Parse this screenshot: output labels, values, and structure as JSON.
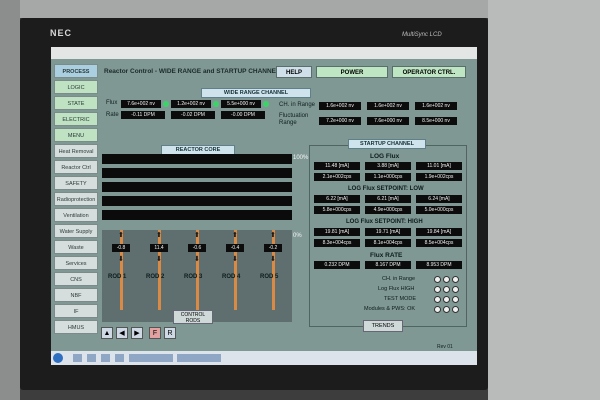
{
  "monitor": {
    "brand": "NEC",
    "model": "MultiSync LCD"
  },
  "header": {
    "title": "Reactor Control - WIDE RANGE and STARTUP CHANNEL",
    "help": "HELP",
    "power": "POWER",
    "operator": "OPERATOR CTRL."
  },
  "nav": [
    "PROCESS",
    "LOGIC",
    "STATE",
    "ELECTRIC",
    "MENU",
    "Heat Removal",
    "Reactor Ctrl",
    "SAFETY",
    "Radioprotection",
    "Ventilation",
    "Water Supply",
    "Waste",
    "Services",
    "CNS",
    "NBF",
    "IF",
    "HMUS"
  ],
  "wide_range": {
    "label": "WIDE RANGE CHANNEL",
    "flux_label": "Flux",
    "rate_label": "Rate",
    "flux_values": [
      "7.6e+002 nv",
      "1.2e+002 nv",
      "5.5e+000 nv"
    ],
    "rate_values": [
      "-0.11 DPM",
      "-0.02 DPM",
      "-0.00 DPM"
    ],
    "ch_in_range_label": "CH. in Range",
    "ch_in_range_values": [
      "1.6e+002 nv",
      "1.6e+002 nv",
      "1.6e+002 nv"
    ],
    "fluct_label": "Fluctuation Range",
    "fluct_values": [
      "7.2e+000 nv",
      "7.6e+000 nv",
      "8.5e+000 nv"
    ]
  },
  "core": {
    "label": "REACTOR CORE",
    "pct_top": "100%",
    "pct_bottom": "0%",
    "rods": [
      {
        "name": "ROD 1",
        "value": "-0.8"
      },
      {
        "name": "ROD 2",
        "value": "11.4"
      },
      {
        "name": "ROD 3",
        "value": "-0.6"
      },
      {
        "name": "ROD 4",
        "value": "-0.4"
      },
      {
        "name": "ROD 5",
        "value": "-0.2"
      }
    ],
    "control_rods_btn": "CONTROL RODS"
  },
  "startup": {
    "label": "STARTUP CHANNEL",
    "log_flux": "LOG Flux",
    "log_flux_ma": [
      "11.48 [mA]",
      "3.88 [mA]",
      "11.01 [mA]"
    ],
    "log_flux_cps": [
      "2.1e+002cps",
      "1.1e+000cps",
      "1.9e+002cps"
    ],
    "low_label": "LOG Flux SETPOINT: LOW",
    "low_ma": [
      "6.22 [mA]",
      "6.21 [mA]",
      "6.24 [mA]"
    ],
    "low_cps": [
      "5.8e+000cps",
      "4.9e+000cps",
      "5.0e+000cps"
    ],
    "high_label": "LOG Flux SETPOINT: HIGH",
    "high_ma": [
      "19.81 [mA]",
      "19.71 [mA]",
      "19.84 [mA]"
    ],
    "high_cps": [
      "8.3e+004cps",
      "8.1e+004cps",
      "8.5e+004cps"
    ],
    "flux_rate": "Flux RATE",
    "flux_rate_values": [
      "0.232 DPM",
      "8.167 DPM",
      "8.953 DPM"
    ],
    "indicators": [
      "CH. in Range",
      "Log Flux HIGH",
      "TEST MODE",
      "Modules & PWS: OK"
    ],
    "trends": "TRENDS"
  },
  "footer": {
    "rev": "Rev 01"
  },
  "colors": {
    "screen_bg": "#7f9894",
    "value_bg": "#0c0c0c",
    "active_nav": "#a9cfe1",
    "ok_green": "#3ed26a"
  }
}
